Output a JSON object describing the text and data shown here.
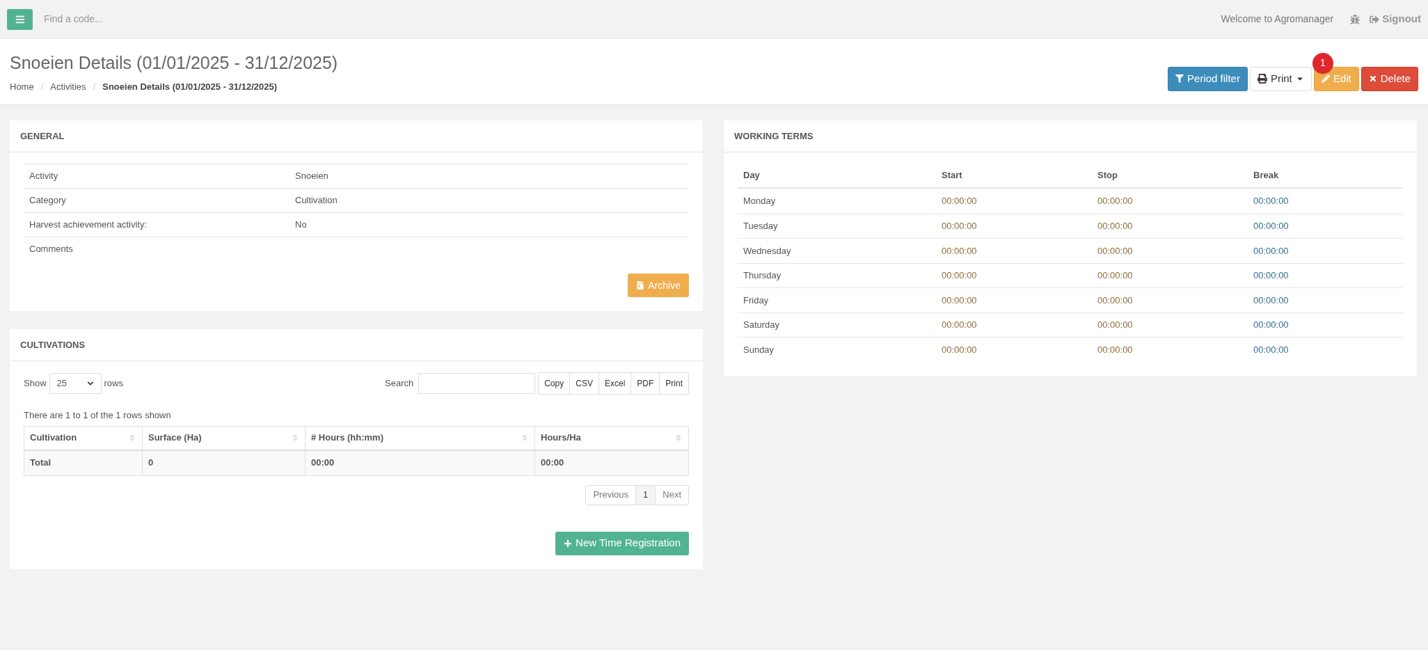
{
  "topbar": {
    "search_placeholder": "Find a code...",
    "welcome": "Welcome to Agromanager",
    "signout": "Signout"
  },
  "header": {
    "title": "Snoeien Details (01/01/2025 - 31/12/2025)",
    "breadcrumb_separator": "/",
    "breadcrumbs": [
      {
        "label": "Home",
        "selected": false
      },
      {
        "label": "Activities",
        "selected": false
      },
      {
        "label": "Snoeien Details (01/01/2025 - 31/12/2025)",
        "selected": true
      }
    ],
    "buttons": [
      {
        "kind": "period",
        "label": "Period filter"
      },
      {
        "kind": "print",
        "label": "Print"
      },
      {
        "kind": "edit",
        "label": "Edit",
        "badge": "1"
      },
      {
        "kind": "delete",
        "label": "Delete"
      }
    ]
  },
  "general": {
    "title": "GENERAL",
    "rows": [
      {
        "label": "Activity",
        "value": "Snoeien"
      },
      {
        "label": "Category",
        "value": "Cultivation"
      },
      {
        "label": "Harvest achievement activity:",
        "value": "No"
      },
      {
        "label": "Comments",
        "value": ""
      }
    ],
    "archive_button": "Archive"
  },
  "cultivations": {
    "title": "CULTIVATIONS",
    "show_label": "Show",
    "page_size": "25",
    "rows_label": "rows",
    "search_label": "Search",
    "export_buttons": [
      "Copy",
      "CSV",
      "Excel",
      "PDF",
      "Print"
    ],
    "info": "There are 1 to 1 of the 1 rows shown",
    "columns": [
      "Cultivation",
      "Surface (Ha)",
      "# Hours (hh:mm)",
      "Hours/Ha"
    ],
    "total_row": [
      "Total",
      "0",
      "00:00",
      "00:00"
    ],
    "pagination": [
      {
        "label": "Previous",
        "selected": false
      },
      {
        "label": "1",
        "selected": true
      },
      {
        "label": "Next",
        "selected": false
      }
    ],
    "new_button": "New Time Registration"
  },
  "working_terms": {
    "title": "WORKING TERMS",
    "columns": [
      {
        "label": "Day",
        "color": "#555555"
      },
      {
        "label": "Start",
        "color": "#8a6d3b"
      },
      {
        "label": "Stop",
        "color": "#8a6d3b"
      },
      {
        "label": "Break",
        "color": "#31708f"
      }
    ],
    "rows": [
      [
        "Monday",
        "00:00:00",
        "00:00:00",
        "00:00:00"
      ],
      [
        "Tuesday",
        "00:00:00",
        "00:00:00",
        "00:00:00"
      ],
      [
        "Wednesday",
        "00:00:00",
        "00:00:00",
        "00:00:00"
      ],
      [
        "Thursday",
        "00:00:00",
        "00:00:00",
        "00:00:00"
      ],
      [
        "Friday",
        "00:00:00",
        "00:00:00",
        "00:00:00"
      ],
      [
        "Saturday",
        "00:00:00",
        "00:00:00",
        "00:00:00"
      ],
      [
        "Sunday",
        "00:00:00",
        "00:00:00",
        "00:00:00"
      ]
    ]
  }
}
